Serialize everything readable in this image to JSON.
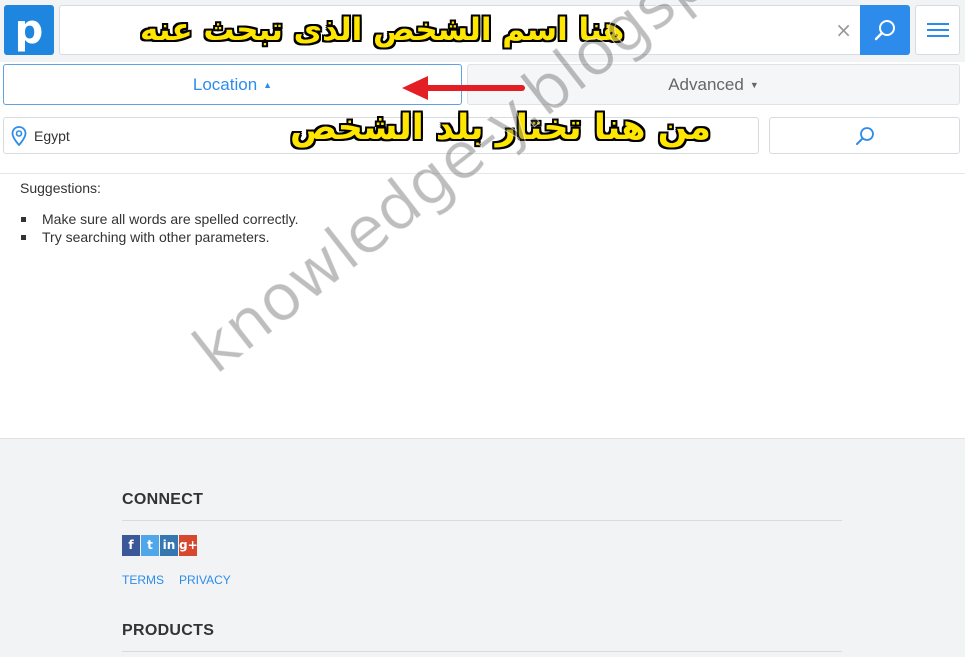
{
  "header": {
    "logo_letter": "p",
    "search": {
      "value": "",
      "placeholder": ""
    },
    "clear_glyph": "×"
  },
  "tabs": [
    {
      "label": "Location",
      "active": true,
      "caret": "▲"
    },
    {
      "label": "Advanced",
      "active": false,
      "caret": "▼"
    }
  ],
  "filter": {
    "location_value": "Egypt"
  },
  "results": {
    "heading": "Suggestions:",
    "items": [
      "Make sure all words are spelled correctly.",
      "Try searching with other parameters."
    ]
  },
  "footer": {
    "connect_heading": "CONNECT",
    "social": [
      {
        "icon": "facebook-icon",
        "glyph": "f"
      },
      {
        "icon": "twitter-icon",
        "glyph": "t"
      },
      {
        "icon": "linkedin-icon",
        "glyph": "in"
      },
      {
        "icon": "googleplus-icon",
        "glyph": "g+"
      }
    ],
    "links": [
      "TERMS",
      "PRIVACY"
    ],
    "products_heading": "PRODUCTS"
  },
  "annotations": {
    "search_hint": "هنا اسم الشخص الذى تبحث عنه",
    "location_hint": "من هنا تختار بلد الشخص"
  },
  "watermark": "knowledge-y.blogspot.com",
  "colors": {
    "brand": "#1f86e0",
    "accent": "#2d8ceb",
    "annotation": "#ffe600",
    "arrow": "#e31e24"
  }
}
